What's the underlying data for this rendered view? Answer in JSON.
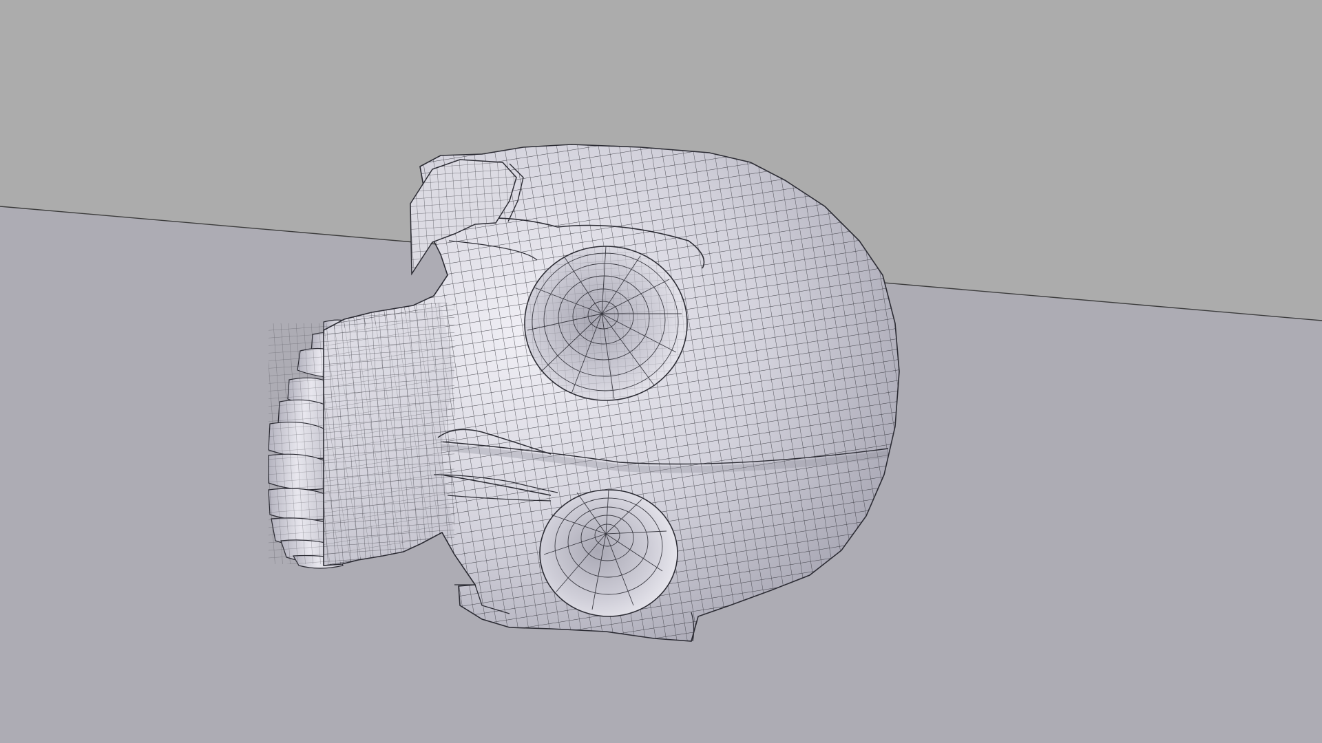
{
  "viewport": {
    "scene": "3d-viewport",
    "object": "skull-mesh",
    "shading": "solid-wireframe",
    "colors": {
      "backdrop_upper": "#acacac",
      "backdrop_lower": "#adacb4",
      "horizon_line": "#3c3c3c",
      "mesh_light": "#ecebf2",
      "mesh_mid": "#c9c8d2",
      "mesh_dark": "#9d9caa",
      "wire": "#2b2b33"
    }
  }
}
